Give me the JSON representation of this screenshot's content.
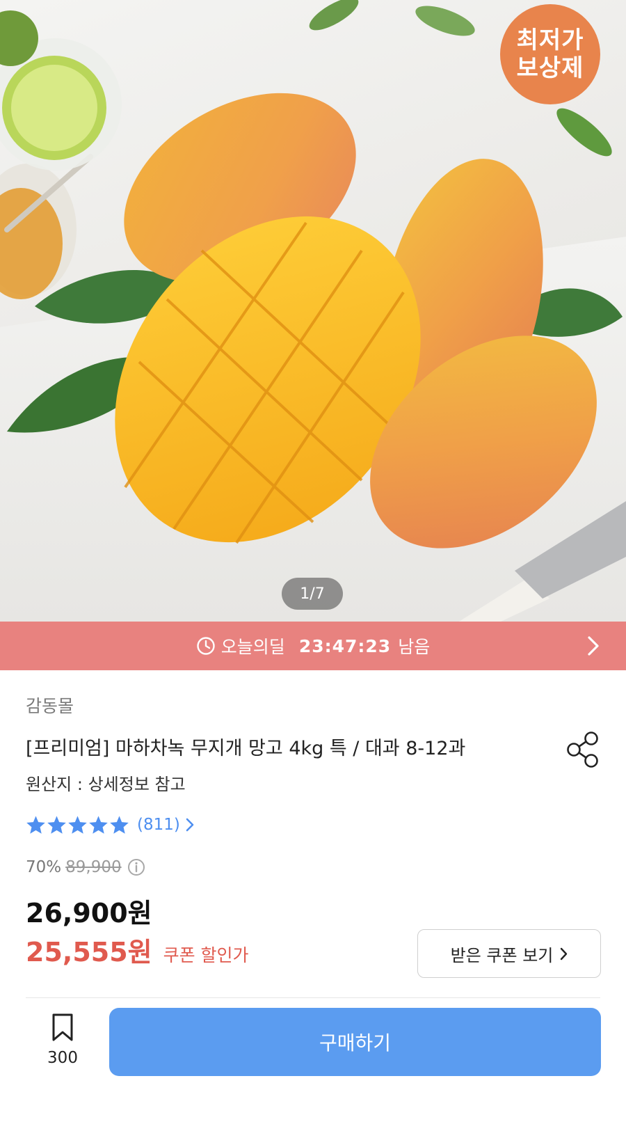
{
  "hero": {
    "badge_line1": "최저가",
    "badge_line2": "보상제",
    "pager": "1/7"
  },
  "deal": {
    "label": "오늘의딜",
    "timer": "23:47:23",
    "suffix": "남음"
  },
  "product": {
    "seller": "감동몰",
    "title": "[프리미엄] 마하차녹 무지개 망고 4kg 특 / 대과 8-12과",
    "origin": "원산지 : 상세정보 참고",
    "rating_stars": 5,
    "review_count": "(811)",
    "discount_rate": "70%",
    "original_price": "89,900",
    "price": "26,900원",
    "coupon_price": "25,555원",
    "coupon_label": "쿠폰 할인가",
    "coupon_button": "받은 쿠폰 보기"
  },
  "bottom": {
    "bookmark_count": "300",
    "buy_label": "구매하기"
  },
  "colors": {
    "deal_bar": "#e8827f",
    "badge": "#e8844c",
    "star": "#4e8ff0",
    "coupon_price": "#e05a4e",
    "buy_button": "#5b9cf0"
  },
  "icons": [
    "clock-icon",
    "chevron-right-icon",
    "share-icon",
    "star-icon",
    "info-icon",
    "bookmark-icon"
  ]
}
